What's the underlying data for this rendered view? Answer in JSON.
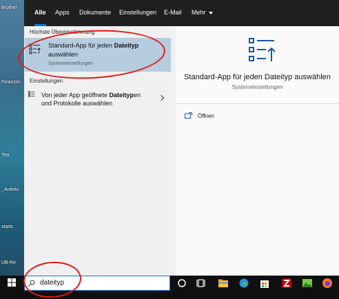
{
  "desktop": {
    "labels": [
      "Brother",
      "Finanzm",
      "Tea",
      "_Anleitu",
      "startc",
      "UB-Re"
    ]
  },
  "tabs": [
    "Alle",
    "Apps",
    "Dokumente",
    "Einstellungen",
    "E-Mail",
    "Mehr"
  ],
  "left": {
    "best_match_heading": "Höchste Übereinstimmung",
    "best_match": {
      "title_line1_prefix": "Standard-App für jeden ",
      "title_line1_bold": "Dateityp",
      "title_line2": "auswählen",
      "subtitle": "Systemeinstellungen"
    },
    "settings_heading": "Einstellungen",
    "setting_item": {
      "line1_prefix": "Von jeder App geöffnete ",
      "line1_bold": "Dateityp",
      "line1_suffix": "en",
      "line2": "und Protokolle auswählen"
    }
  },
  "right": {
    "title": "Standard-App für jeden Dateityp auswählen",
    "subtitle": "Systemeinstellungen",
    "action_open": "Öffnen"
  },
  "taskbar": {
    "search_value": "dateityp",
    "icons": [
      "cortana-icon",
      "task-view-icon",
      "file-explorer-icon",
      "edge-icon",
      "store-icon",
      "filezilla-icon",
      "photos-icon",
      "firefox-icon"
    ]
  },
  "colors": {
    "accent": "#0078d7",
    "highlight": "#b6cde0",
    "annotation": "#e01919"
  }
}
